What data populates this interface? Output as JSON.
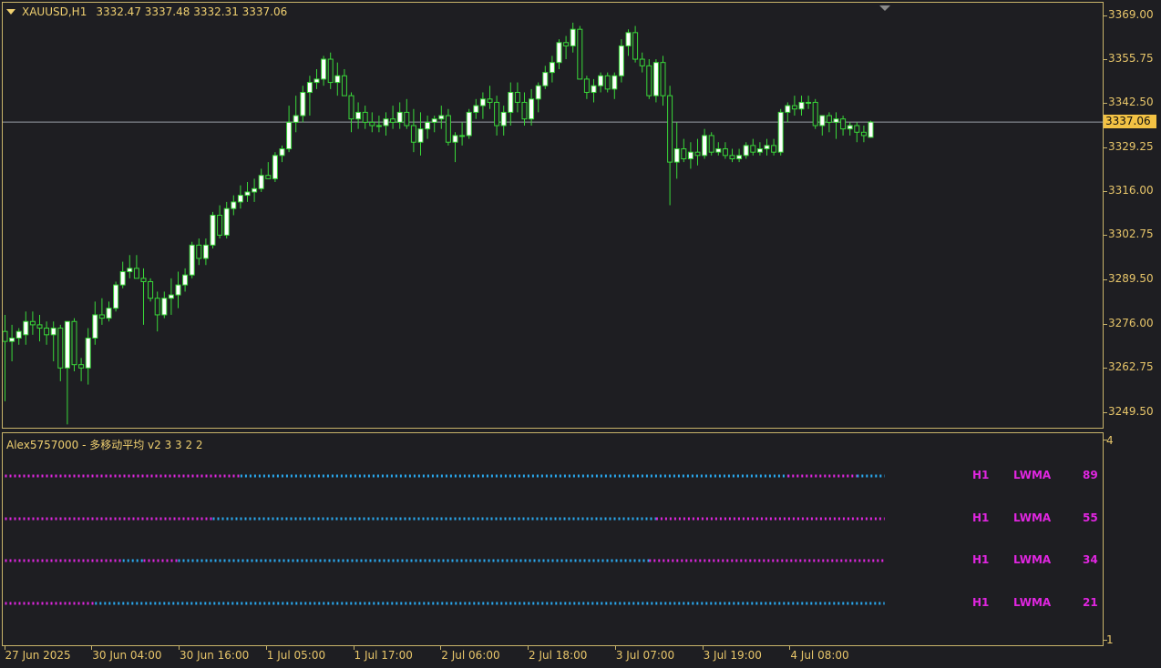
{
  "header": {
    "symbol": "XAUUSD,H1",
    "ohlc": "3332.47 3337.48 3332.31 3337.06"
  },
  "price_axis": {
    "ticks": [
      "3369.00",
      "3355.75",
      "3342.50",
      "3329.25",
      "3316.00",
      "3302.75",
      "3289.50",
      "3276.00",
      "3262.75",
      "3249.50"
    ],
    "current_price": "3337.06"
  },
  "time_axis": {
    "labels": [
      "27 Jun 2025",
      "30 Jun 04:00",
      "30 Jun 16:00",
      "1 Jul 05:00",
      "1 Jul 17:00",
      "2 Jul 06:00",
      "2 Jul 18:00",
      "3 Jul 07:00",
      "3 Jul 19:00",
      "4 Jul 08:00"
    ]
  },
  "indicator": {
    "title": "Alex5757000 - 多移动平均 v2 3 3 2 2",
    "scale_top": "4",
    "scale_bottom": "1",
    "rows": [
      {
        "tf": "H1",
        "method": "LWMA",
        "period": "89"
      },
      {
        "tf": "H1",
        "method": "LWMA",
        "period": "55"
      },
      {
        "tf": "H1",
        "method": "LWMA",
        "period": "34"
      },
      {
        "tf": "H1",
        "method": "LWMA",
        "period": "21"
      }
    ],
    "colors": {
      "up": "#29a9f0",
      "down": "#e026e0"
    }
  },
  "colors": {
    "background": "#1e1e22",
    "frame": "#c9b46a",
    "axis_text": "#e8c66a",
    "bull_candle": "#ffffff",
    "bear_candle": "#1e1e22",
    "wick": "#39d839",
    "price_line": "#9aa0a8",
    "price_label_bg": "#f3c244"
  },
  "chart_data": {
    "type": "candlestick",
    "ylim": [
      3245,
      3373
    ],
    "candles": [
      [
        3274,
        3279,
        3253,
        3271
      ],
      [
        3271,
        3276,
        3265,
        3272
      ],
      [
        3272,
        3275,
        3270,
        3274
      ],
      [
        3273,
        3280,
        3270,
        3277
      ],
      [
        3277,
        3280,
        3273,
        3276
      ],
      [
        3276,
        3279,
        3271,
        3275
      ],
      [
        3275,
        3277,
        3270,
        3273
      ],
      [
        3273,
        3277,
        3265,
        3275
      ],
      [
        3275,
        3276,
        3259,
        3263
      ],
      [
        3263,
        3276,
        3246,
        3277
      ],
      [
        3277,
        3278,
        3262,
        3264
      ],
      [
        3264,
        3266,
        3259,
        3263
      ],
      [
        3263,
        3275,
        3258,
        3272
      ],
      [
        3272,
        3283,
        3270,
        3279
      ],
      [
        3279,
        3284,
        3276,
        3278
      ],
      [
        3278,
        3283,
        3277,
        3281
      ],
      [
        3281,
        3289,
        3280,
        3288
      ],
      [
        3288,
        3295,
        3287,
        3292
      ],
      [
        3292,
        3297,
        3290,
        3293
      ],
      [
        3293,
        3297,
        3290,
        3290
      ],
      [
        3290,
        3293,
        3276,
        3289
      ],
      [
        3289,
        3290,
        3283,
        3284
      ],
      [
        3284,
        3286,
        3274,
        3279
      ],
      [
        3279,
        3286,
        3278,
        3284
      ],
      [
        3284,
        3290,
        3279,
        3285
      ],
      [
        3285,
        3292,
        3281,
        3288
      ],
      [
        3288,
        3293,
        3286,
        3291
      ],
      [
        3291,
        3301,
        3290,
        3300
      ],
      [
        3300,
        3302,
        3294,
        3296
      ],
      [
        3296,
        3302,
        3294,
        3300
      ],
      [
        3300,
        3310,
        3299,
        3309
      ],
      [
        3309,
        3312,
        3302,
        3303
      ],
      [
        3303,
        3313,
        3302,
        3311
      ],
      [
        3311,
        3315,
        3309,
        3313
      ],
      [
        3313,
        3318,
        3311,
        3315
      ],
      [
        3315,
        3319,
        3313,
        3316
      ],
      [
        3316,
        3320,
        3313,
        3317
      ],
      [
        3317,
        3323,
        3316,
        3321
      ],
      [
        3321,
        3325,
        3320,
        3320
      ],
      [
        3320,
        3328,
        3319,
        3327
      ],
      [
        3327,
        3330,
        3325,
        3329
      ],
      [
        3329,
        3342,
        3328,
        3337
      ],
      [
        3337,
        3345,
        3334,
        3339
      ],
      [
        3339,
        3348,
        3337,
        3346
      ],
      [
        3346,
        3351,
        3339,
        3349
      ],
      [
        3349,
        3353,
        3347,
        3350
      ],
      [
        3350,
        3357,
        3348,
        3356
      ],
      [
        3356,
        3358,
        3347,
        3349
      ],
      [
        3349,
        3355,
        3345,
        3351
      ],
      [
        3351,
        3353,
        3345,
        3345
      ],
      [
        3345,
        3346,
        3334,
        3338
      ],
      [
        3338,
        3343,
        3335,
        3340
      ],
      [
        3340,
        3342,
        3335,
        3337
      ],
      [
        3337,
        3340,
        3334,
        3336
      ],
      [
        3336,
        3339,
        3334,
        3336
      ],
      [
        3336,
        3340,
        3333,
        3338
      ],
      [
        3338,
        3342,
        3335,
        3337
      ],
      [
        3337,
        3343,
        3335,
        3340
      ],
      [
        3340,
        3344,
        3335,
        3336
      ],
      [
        3336,
        3341,
        3328,
        3331
      ],
      [
        3331,
        3340,
        3327,
        3335
      ],
      [
        3335,
        3339,
        3332,
        3337
      ],
      [
        3337,
        3339,
        3334,
        3338
      ],
      [
        3338,
        3342,
        3335,
        3339
      ],
      [
        3339,
        3341,
        3330,
        3331
      ],
      [
        3331,
        3334,
        3325,
        3333
      ],
      [
        3333,
        3337,
        3330,
        3333
      ],
      [
        3333,
        3341,
        3332,
        3340
      ],
      [
        3340,
        3344,
        3338,
        3342
      ],
      [
        3342,
        3346,
        3338,
        3344
      ],
      [
        3344,
        3348,
        3341,
        3343
      ],
      [
        3343,
        3345,
        3333,
        3336
      ],
      [
        3336,
        3342,
        3333,
        3340
      ],
      [
        3340,
        3349,
        3336,
        3346
      ],
      [
        3346,
        3349,
        3340,
        3343
      ],
      [
        3343,
        3346,
        3336,
        3338
      ],
      [
        3338,
        3347,
        3336,
        3344
      ],
      [
        3344,
        3349,
        3340,
        3348
      ],
      [
        3348,
        3354,
        3347,
        3352
      ],
      [
        3352,
        3357,
        3349,
        3355
      ],
      [
        3355,
        3362,
        3353,
        3361
      ],
      [
        3361,
        3363,
        3356,
        3360
      ],
      [
        3360,
        3367,
        3358,
        3365
      ],
      [
        3365,
        3366,
        3350,
        3350
      ],
      [
        3350,
        3351,
        3344,
        3346
      ],
      [
        3346,
        3350,
        3343,
        3348
      ],
      [
        3348,
        3352,
        3346,
        3351
      ],
      [
        3351,
        3352,
        3346,
        3347
      ],
      [
        3347,
        3352,
        3344,
        3351
      ],
      [
        3351,
        3362,
        3349,
        3360
      ],
      [
        3360,
        3365,
        3357,
        3364
      ],
      [
        3364,
        3366,
        3355,
        3356
      ],
      [
        3356,
        3358,
        3352,
        3354
      ],
      [
        3354,
        3356,
        3344,
        3345
      ],
      [
        3345,
        3356,
        3343,
        3355
      ],
      [
        3355,
        3357,
        3342,
        3345
      ],
      [
        3345,
        3348,
        3312,
        3325
      ],
      [
        3325,
        3337,
        3320,
        3329
      ],
      [
        3329,
        3332,
        3325,
        3326
      ],
      [
        3326,
        3331,
        3323,
        3328
      ],
      [
        3328,
        3332,
        3324,
        3327
      ],
      [
        3327,
        3335,
        3326,
        3333
      ],
      [
        3333,
        3334,
        3327,
        3328
      ],
      [
        3328,
        3331,
        3327,
        3329
      ],
      [
        3329,
        3331,
        3326,
        3327
      ],
      [
        3327,
        3329,
        3325,
        3326
      ],
      [
        3326,
        3329,
        3325,
        3327
      ],
      [
        3327,
        3331,
        3326,
        3330
      ],
      [
        3330,
        3332,
        3327,
        3328
      ],
      [
        3328,
        3331,
        3327,
        3329
      ],
      [
        3329,
        3332,
        3327,
        3330
      ],
      [
        3330,
        3332,
        3327,
        3328
      ],
      [
        3328,
        3341,
        3327,
        3340
      ],
      [
        3340,
        3343,
        3337,
        3342
      ],
      [
        3342,
        3345,
        3339,
        3341
      ],
      [
        3341,
        3345,
        3339,
        3343
      ],
      [
        3343,
        3345,
        3341,
        3343
      ],
      [
        3343,
        3344,
        3335,
        3336
      ],
      [
        3336,
        3339,
        3333,
        3339
      ],
      [
        3339,
        3340,
        3334,
        3337
      ],
      [
        3337,
        3340,
        3332,
        3338
      ],
      [
        3338,
        3339,
        3333,
        3335
      ],
      [
        3335,
        3337,
        3333,
        3336
      ],
      [
        3336,
        3337,
        3331,
        3334
      ],
      [
        3334,
        3336,
        3331,
        3333
      ],
      [
        3332.47,
        3337.48,
        3332.31,
        3337.06
      ]
    ],
    "ma_rows": [
      {
        "name": "LWMA 89",
        "segments": [
          [
            "down",
            0,
            34
          ],
          [
            "up",
            34,
            113
          ],
          [
            "down",
            113,
            123
          ],
          [
            "up",
            123,
            127
          ]
        ]
      },
      {
        "name": "LWMA 55",
        "segments": [
          [
            "down",
            0,
            30
          ],
          [
            "up",
            30,
            94
          ],
          [
            "down",
            94,
            127
          ]
        ]
      },
      {
        "name": "LWMA 34",
        "segments": [
          [
            "down",
            0,
            17
          ],
          [
            "up",
            17,
            20
          ],
          [
            "down",
            20,
            25
          ],
          [
            "up",
            25,
            93
          ],
          [
            "down",
            93,
            127
          ]
        ]
      },
      {
        "name": "LWMA 21",
        "segments": [
          [
            "down",
            0,
            13
          ],
          [
            "up",
            13,
            127
          ]
        ]
      }
    ]
  }
}
